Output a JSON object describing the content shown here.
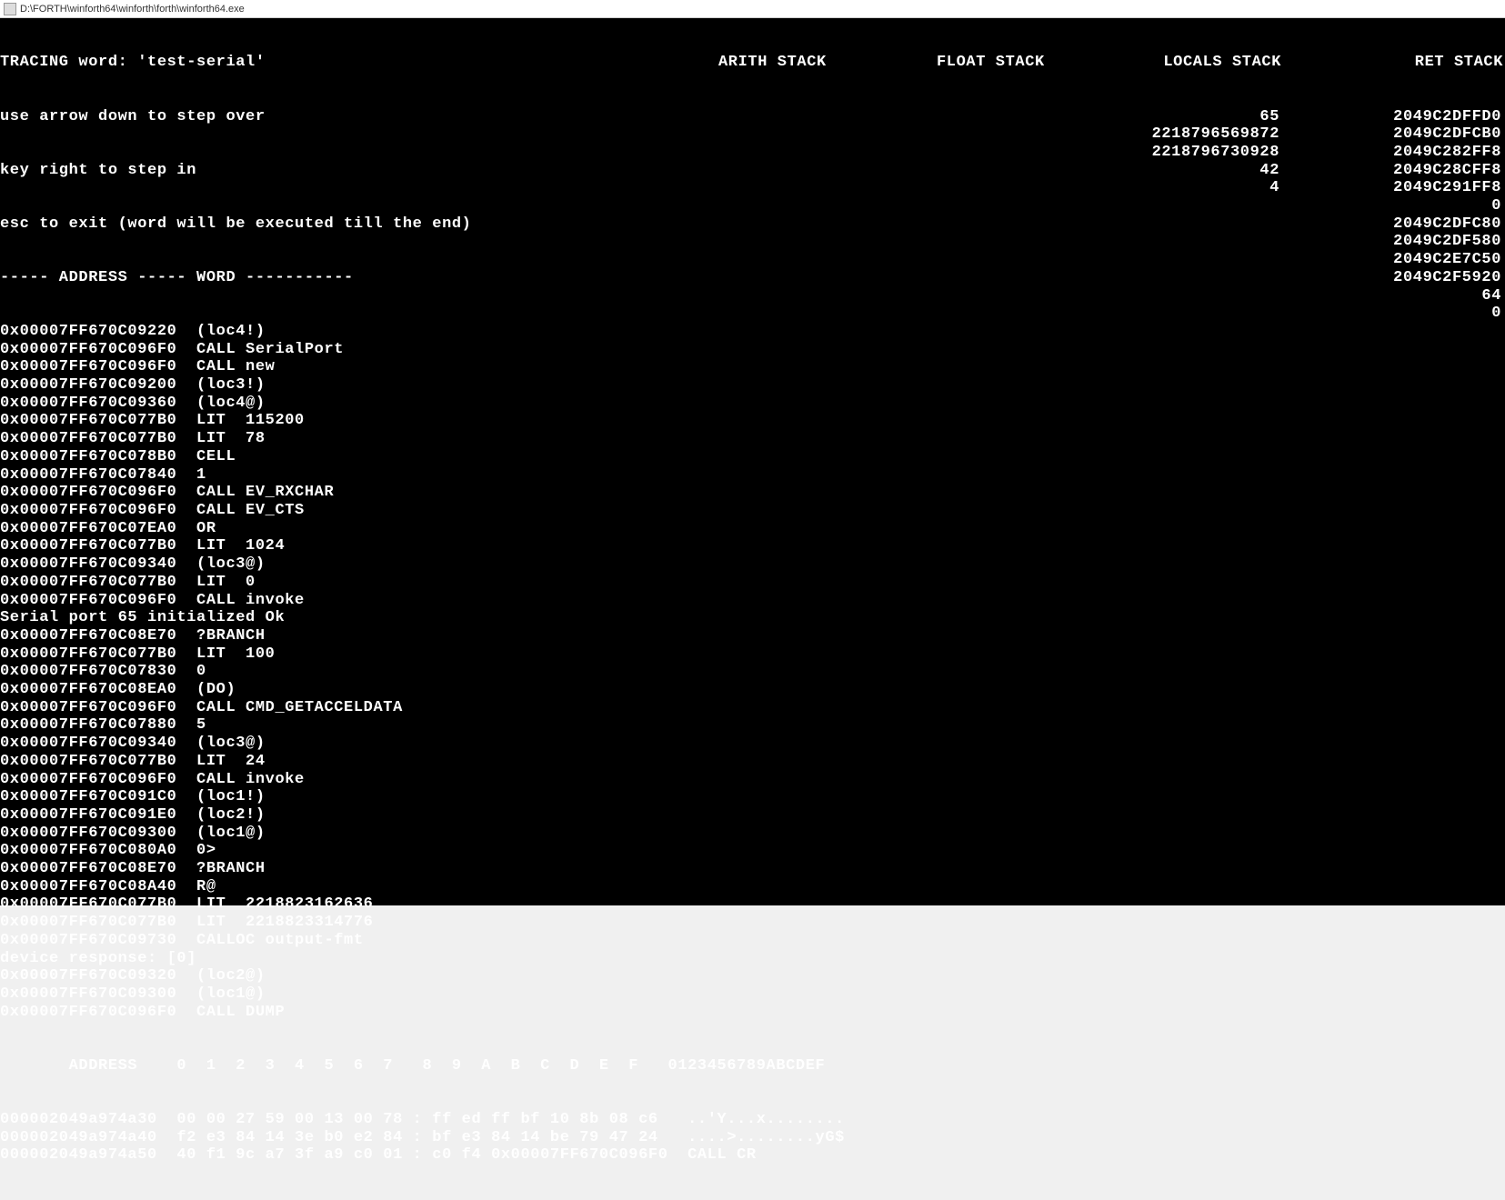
{
  "titlebar": {
    "path": "D:\\FORTH\\winforth64\\winforth\\forth\\winforth64.exe"
  },
  "header": {
    "tracing_line": "TRACING word: 'test-serial'",
    "help1": "use arrow down to step over",
    "help2": "key right to step in",
    "help3": "esc to exit (word will be executed till the end)",
    "columns": "----- ADDRESS ----- WORD -----------"
  },
  "stacks": {
    "arith": {
      "label": "ARITH STACK",
      "values": []
    },
    "float": {
      "label": "FLOAT STACK",
      "values": []
    },
    "locals": {
      "label": "LOCALS STACK",
      "values": [
        "65",
        "2218796569872",
        "2218796730928",
        "42",
        "4"
      ]
    },
    "ret": {
      "label": "RET STACK",
      "values": [
        "2049C2DFFD0",
        "2049C2DFCB0",
        "2049C282FF8",
        "2049C28CFF8",
        "2049C291FF8",
        "0",
        "2049C2DFC80",
        "2049C2DF580",
        "2049C2E7C50",
        "2049C2F5920",
        "64",
        "0"
      ]
    }
  },
  "trace": [
    {
      "addr": "0x00007FF670C09220",
      "word": "(loc4!)"
    },
    {
      "addr": "0x00007FF670C096F0",
      "word": "CALL SerialPort"
    },
    {
      "addr": "0x00007FF670C096F0",
      "word": "CALL new"
    },
    {
      "addr": "0x00007FF670C09200",
      "word": "(loc3!)"
    },
    {
      "addr": "0x00007FF670C09360",
      "word": "(loc4@)"
    },
    {
      "addr": "0x00007FF670C077B0",
      "word": "LIT  115200"
    },
    {
      "addr": "0x00007FF670C077B0",
      "word": "LIT  78"
    },
    {
      "addr": "0x00007FF670C078B0",
      "word": "CELL"
    },
    {
      "addr": "0x00007FF670C07840",
      "word": "1"
    },
    {
      "addr": "0x00007FF670C096F0",
      "word": "CALL EV_RXCHAR"
    },
    {
      "addr": "0x00007FF670C096F0",
      "word": "CALL EV_CTS"
    },
    {
      "addr": "0x00007FF670C07EA0",
      "word": "OR"
    },
    {
      "addr": "0x00007FF670C077B0",
      "word": "LIT  1024"
    },
    {
      "addr": "0x00007FF670C09340",
      "word": "(loc3@)"
    },
    {
      "addr": "0x00007FF670C077B0",
      "word": "LIT  0"
    },
    {
      "addr": "0x00007FF670C096F0",
      "word": "CALL invoke"
    },
    {
      "addr": "Serial port 65 initialized Ok",
      "word": ""
    },
    {
      "addr": "0x00007FF670C08E70",
      "word": "?BRANCH"
    },
    {
      "addr": "0x00007FF670C077B0",
      "word": "LIT  100"
    },
    {
      "addr": "0x00007FF670C07830",
      "word": "0"
    },
    {
      "addr": "0x00007FF670C08EA0",
      "word": "(DO)"
    },
    {
      "addr": "0x00007FF670C096F0",
      "word": "CALL CMD_GETACCELDATA"
    },
    {
      "addr": "0x00007FF670C07880",
      "word": "5"
    },
    {
      "addr": "0x00007FF670C09340",
      "word": "(loc3@)"
    },
    {
      "addr": "0x00007FF670C077B0",
      "word": "LIT  24"
    },
    {
      "addr": "0x00007FF670C096F0",
      "word": "CALL invoke"
    },
    {
      "addr": "0x00007FF670C091C0",
      "word": "(loc1!)"
    },
    {
      "addr": "0x00007FF670C091E0",
      "word": "(loc2!)"
    },
    {
      "addr": "0x00007FF670C09300",
      "word": "(loc1@)"
    },
    {
      "addr": "0x00007FF670C080A0",
      "word": "0>"
    },
    {
      "addr": "0x00007FF670C08E70",
      "word": "?BRANCH"
    },
    {
      "addr": "0x00007FF670C08A40",
      "word": "R@"
    },
    {
      "addr": "0x00007FF670C077B0",
      "word": "LIT  2218823162636"
    },
    {
      "addr": "0x00007FF670C077B0",
      "word": "LIT  2218823314776"
    },
    {
      "addr": "0x00007FF670C09730",
      "word": "CALLOC output-fmt"
    },
    {
      "addr": "device response: [0]",
      "word": ""
    },
    {
      "addr": "0x00007FF670C09320",
      "word": "(loc2@)"
    },
    {
      "addr": "0x00007FF670C09300",
      "word": "(loc1@)"
    },
    {
      "addr": "0x00007FF670C096F0",
      "word": "CALL DUMP"
    }
  ],
  "dump": {
    "header": "       ADDRESS    0  1  2  3  4  5  6  7   8  9  A  B  C  D  E  F   0123456789ABCDEF",
    "rows": [
      "000002049a974a30  00 00 27 59 00 13 00 78 : ff ed ff bf 10 8b 08 c6   ..'Y...x........",
      "000002049a974a40  f2 e3 84 14 3e b0 e2 84 : bf e3 84 14 be 79 47 24   ....>........yG$",
      "000002049a974a50  40 f1 9c a7 3f a9 c0 01 : c0 f4 0x00007FF670C096F0  CALL CR"
    ]
  }
}
